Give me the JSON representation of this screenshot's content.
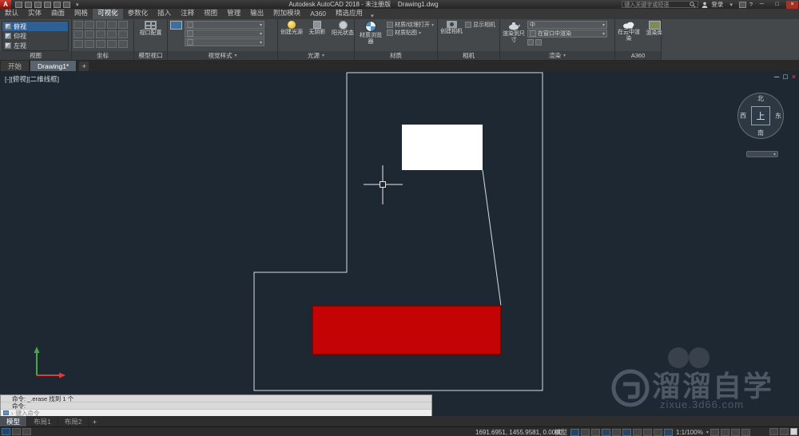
{
  "icons": {
    "caret_down": "▾",
    "plus": "+",
    "minimize": "─",
    "restore": "□",
    "close": "×",
    "help": "?",
    "prompt": "›"
  },
  "title_bar": {
    "app_title": "Autodesk AutoCAD 2018 - 未注册版",
    "doc_title": "Drawing1.dwg",
    "search_placeholder": "键入关键字或短语",
    "sign_in": "登录"
  },
  "ribbon": {
    "tabs": [
      "默认",
      "实体",
      "曲面",
      "网格",
      "可视化",
      "参数化",
      "插入",
      "注释",
      "视图",
      "管理",
      "输出",
      "附加模块",
      "A360",
      "精选应用"
    ],
    "view_panel": {
      "label": "视图",
      "items": [
        "俯视",
        "仰视",
        "左视"
      ]
    },
    "coord_panel": {
      "label": "坐标"
    },
    "viewport_panel": {
      "label": "模型视口",
      "button": "视口配置"
    },
    "visual_panel": {
      "label": "视觉样式"
    },
    "light_panel": {
      "label": "光源",
      "create": "创建光源",
      "no_shadow": "无阴影",
      "sun": "阳光状态"
    },
    "material_panel": {
      "label": "材质",
      "browser": "材质浏览器",
      "open": "材质/纹理打开",
      "mapping": "材质贴图"
    },
    "camera_panel": {
      "label": "相机",
      "create": "创建相机",
      "show": "显示相机"
    },
    "render_panel": {
      "label": "渲染",
      "render_btn": "渲染到尺寸",
      "preset": "中",
      "target": "在窗口中渲染"
    },
    "a360_panel": {
      "label": "A360",
      "cloud": "在云中渲染",
      "gallery": "渲染库"
    }
  },
  "file_tabs": {
    "start": "开始",
    "drawing": "Drawing1*"
  },
  "drawing": {
    "viewport_label": "[-][俯视][二维线框]",
    "viewcube": {
      "n": "北",
      "s": "南",
      "w": "西",
      "e": "东",
      "top": "上"
    }
  },
  "command": {
    "line1": "命令: _.erase 找到 1 个",
    "line2": "命令:",
    "placeholder": "键入命令"
  },
  "layout_tabs": {
    "model": "模型",
    "layout1": "布局1",
    "layout2": "布局2"
  },
  "status_bar": {
    "coordinates": "1691.6951, 1455.9581, 0.0000",
    "model_label": "模型",
    "scale": "1:1/100%"
  },
  "watermark": {
    "brand": "溜溜自学",
    "url": "zixue.3d66.com"
  },
  "colors": {
    "accent": "#2c6096",
    "red_fill": "#c40404",
    "canvas_bg": "#1e2833",
    "outline": "#d8dcdf"
  }
}
